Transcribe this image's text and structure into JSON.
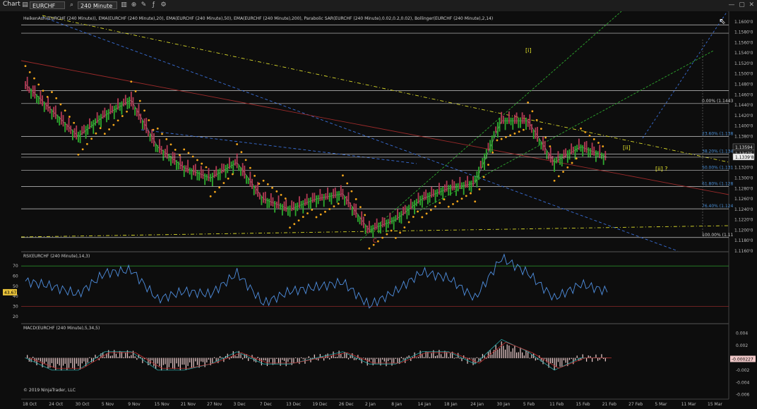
{
  "toolbar": {
    "app_label": "Chart",
    "instrument": "EURCHF",
    "interval": "240 Minute"
  },
  "panels": {
    "price_header": "HeikenAshi(EURCHF (240 Minute)), EMA(EURCHF (240 Minute),20), EMA(EURCHF (240 Minute),50), EMA(EURCHF (240 Minute),200), Parabolic SAR(EURCHF (240 Minute),0.02,0.2,0.02), Bollinger(EURCHF (240 Minute),2,14)",
    "rsi_header": "RSI(EURCHF (240 Minute),14,3)",
    "macd_header": "MACD(EURCHF (240 Minute),5,34,5)",
    "copyright": "© 2019 NinjaTrader, LLC"
  },
  "price_axis": [
    "1.1600'0",
    "1.1580'0",
    "1.1560'0",
    "1.1540'0",
    "1.1520'0",
    "1.1500'0",
    "1.1480'0",
    "1.1460'0",
    "1.1440'0",
    "1.1420'0",
    "1.1400'0",
    "1.1380'0",
    "1.1360'0",
    "1.1340'0",
    "1.1320'0",
    "1.1300'0",
    "1.1280'0",
    "1.1260'0",
    "1.1240'0",
    "1.1220'0",
    "1.1200'0",
    "1.1180'0",
    "1.1160'0"
  ],
  "price_markers": {
    "upper": "1.13594",
    "lower": "1.13475",
    "last": "1.1339'8"
  },
  "rsi_axis": [
    "70",
    "60",
    "50",
    "40",
    "30",
    "20"
  ],
  "rsi_value": "43.67",
  "macd_axis": [
    "0.004",
    "0.002",
    "-0.002",
    "-0.004",
    "-0.006"
  ],
  "macd_value": "-0.000227",
  "fib_labels": [
    "0.00% (1.1443",
    "23.60% (1.138",
    "38.20% (1.134",
    "50.00% (1.131",
    "61.80% (1.128",
    "76.40% (1.124",
    "100.00% (1.11"
  ],
  "wave_labels": {
    "wave_i": "[i]",
    "wave_ii": "[ii]",
    "wave_ii_q": "[ii] ?",
    "wave_c": "C"
  },
  "date_axis": [
    "18 Oct",
    "24 Oct",
    "30 Oct",
    "5 Nov",
    "9 Nov",
    "15 Nov",
    "21 Nov",
    "27 Nov",
    "3 Dec",
    "7 Dec",
    "13 Dec",
    "19 Dec",
    "26 Dec",
    "2 Jan",
    "8 Jan",
    "14 Jan",
    "18 Jan",
    "24 Jan",
    "30 Jan",
    "5 Feb",
    "11 Feb",
    "15 Feb",
    "21 Feb",
    "27 Feb",
    "5 Mar",
    "11 Mar",
    "15 Mar"
  ],
  "colors": {
    "sar": "#f2a51a",
    "fib": "#c9c9c9",
    "blue_line": "#3a6fd8",
    "yellow_line": "#d9d92a",
    "green_line": "#2ea82e",
    "red_line": "#9b2a2a",
    "bull": "#2faa2f",
    "bear": "#b23a55"
  },
  "chart_data": {
    "type": "line",
    "instrument": "EURCHF",
    "interval": "240 Minute",
    "x": [
      "18 Oct",
      "24 Oct",
      "30 Oct",
      "5 Nov",
      "9 Nov",
      "15 Nov",
      "21 Nov",
      "27 Nov",
      "3 Dec",
      "7 Dec",
      "13 Dec",
      "19 Dec",
      "26 Dec",
      "2 Jan",
      "8 Jan",
      "14 Jan",
      "18 Jan",
      "24 Jan",
      "30 Jan",
      "5 Feb",
      "11 Feb",
      "15 Feb",
      "21 Feb"
    ],
    "series": [
      {
        "name": "EURCHF",
        "values": [
          1.148,
          1.143,
          1.138,
          1.142,
          1.145,
          1.136,
          1.132,
          1.13,
          1.133,
          1.126,
          1.124,
          1.126,
          1.127,
          1.12,
          1.122,
          1.126,
          1.128,
          1.129,
          1.141,
          1.141,
          1.133,
          1.136,
          1.134
        ]
      },
      {
        "name": "RSI",
        "values": [
          55,
          50,
          42,
          63,
          66,
          37,
          45,
          42,
          63,
          33,
          45,
          49,
          54,
          31,
          45,
          64,
          58,
          38,
          78,
          63,
          38,
          52,
          45
        ]
      },
      {
        "name": "MACD",
        "values": [
          0.0,
          -0.002,
          -0.002,
          0.001,
          0.001,
          -0.002,
          -0.002,
          -0.001,
          0.001,
          -0.001,
          -0.001,
          0.0,
          0.001,
          -0.001,
          -0.001,
          0.001,
          0.001,
          -0.001,
          0.003,
          0.001,
          -0.002,
          0.0,
          0.0
        ]
      }
    ],
    "ylim": [
      1.116,
      1.162
    ],
    "rsi_ylim": [
      15,
      82
    ],
    "macd_ylim": [
      -0.0065,
      0.005
    ]
  }
}
